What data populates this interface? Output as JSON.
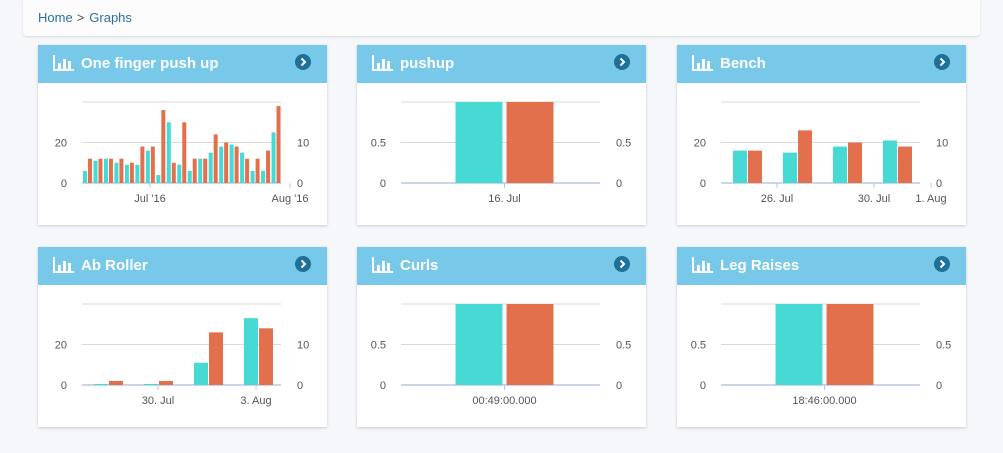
{
  "breadcrumb": {
    "home": "Home",
    "separator": ">",
    "current": "Graphs"
  },
  "colors": {
    "series1": "#47d9d3",
    "series2": "#e2704c",
    "header": "#78c8ea",
    "button": "#1f6f96",
    "grid": "#d9d9d9",
    "baseline": "#b8c8e0"
  },
  "cards": [
    {
      "title": "One finger push up",
      "chart_data": {
        "type": "bar",
        "x_axis": "time",
        "x_ticks": [
          "Jul '16",
          "Aug '16"
        ],
        "y_left": {
          "ticks": [
            "0",
            "20"
          ],
          "max": 40
        },
        "y_right": {
          "ticks": [
            "0",
            "10"
          ],
          "max": 20
        },
        "series": [
          {
            "axis": "left",
            "values": [
              6,
              11,
              12,
              10,
              9,
              9,
              16,
              4,
              30,
              9,
              6,
              12,
              15,
              18,
              19,
              15,
              6,
              6,
              25
            ]
          },
          {
            "axis": "right",
            "values": [
              6,
              6,
              6,
              6,
              5,
              9,
              9,
              18,
              5,
              15,
              6,
              6,
              12,
              10,
              9,
              6,
              6,
              8,
              19
            ]
          }
        ]
      }
    },
    {
      "title": "pushup",
      "chart_data": {
        "type": "bar",
        "categories": [
          "16. Jul"
        ],
        "y_left": {
          "ticks": [
            "0",
            "0.5"
          ],
          "max": 1
        },
        "y_right": {
          "ticks": [
            "0",
            "0.5"
          ],
          "max": 1
        },
        "series": [
          {
            "axis": "left",
            "values": [
              1
            ]
          },
          {
            "axis": "right",
            "values": [
              1
            ]
          }
        ]
      }
    },
    {
      "title": "Bench",
      "chart_data": {
        "type": "bar",
        "x_axis": "time",
        "x_ticks": [
          "26. Jul",
          "30. Jul",
          "1. Aug"
        ],
        "y_left": {
          "ticks": [
            "0",
            "20"
          ],
          "max": 40
        },
        "y_right": {
          "ticks": [
            "0",
            "10"
          ],
          "max": 20
        },
        "series": [
          {
            "axis": "left",
            "values": [
              16,
              15,
              18,
              21
            ]
          },
          {
            "axis": "right",
            "values": [
              8,
              13,
              10,
              9
            ]
          }
        ]
      }
    },
    {
      "title": "Ab Roller",
      "chart_data": {
        "type": "bar",
        "x_axis": "time",
        "x_ticks": [
          "30. Jul",
          "3. Aug"
        ],
        "y_left": {
          "ticks": [
            "0",
            "20"
          ],
          "max": 40
        },
        "y_right": {
          "ticks": [
            "0",
            "10"
          ],
          "max": 20
        },
        "series": [
          {
            "axis": "left",
            "values": [
              0.5,
              0.5,
              11,
              33
            ]
          },
          {
            "axis": "right",
            "values": [
              1,
              1,
              13,
              14
            ]
          }
        ]
      }
    },
    {
      "title": "Curls",
      "chart_data": {
        "type": "bar",
        "categories": [
          "00:49:00.000"
        ],
        "y_left": {
          "ticks": [
            "0",
            "0.5"
          ],
          "max": 1
        },
        "y_right": {
          "ticks": [
            "0",
            "0.5"
          ],
          "max": 1
        },
        "series": [
          {
            "axis": "left",
            "values": [
              1
            ]
          },
          {
            "axis": "right",
            "values": [
              1
            ]
          }
        ]
      }
    },
    {
      "title": "Leg Raises",
      "chart_data": {
        "type": "bar",
        "categories": [
          "18:46:00.000"
        ],
        "y_left": {
          "ticks": [
            "0",
            "0.5"
          ],
          "max": 1
        },
        "y_right": {
          "ticks": [
            "0",
            "0.5"
          ],
          "max": 1
        },
        "series": [
          {
            "axis": "left",
            "values": [
              1
            ]
          },
          {
            "axis": "right",
            "values": [
              1
            ]
          }
        ]
      }
    }
  ]
}
